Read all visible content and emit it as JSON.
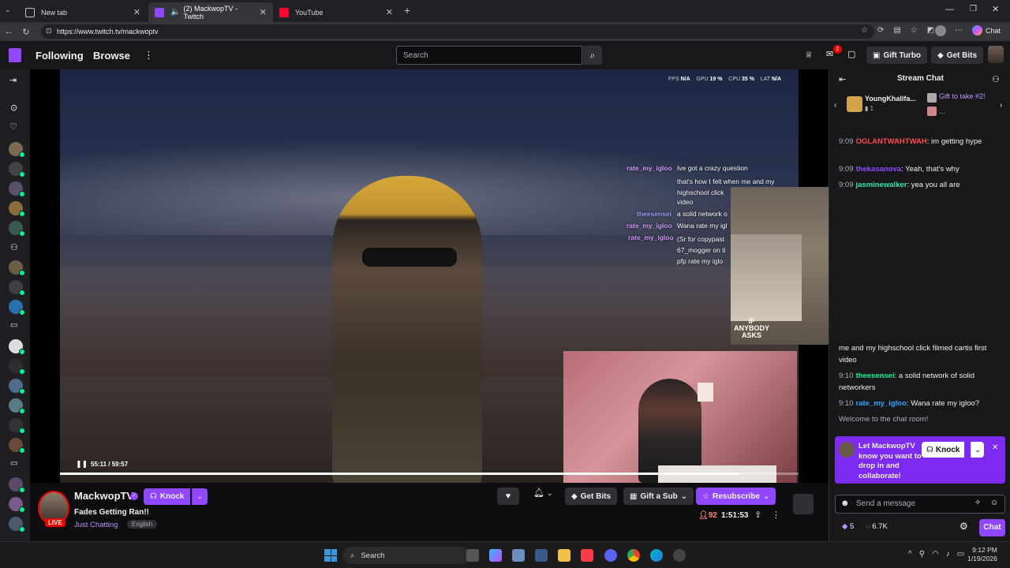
{
  "browser": {
    "tabs": [
      {
        "label": "New tab",
        "active": false
      },
      {
        "label": "(2) MackwopTV - Twitch",
        "active": true
      },
      {
        "label": "YouTube",
        "active": false
      }
    ],
    "url": "https://www.twitch.tv/mackwoptv",
    "copilot_label": "Chat"
  },
  "twitch_nav": {
    "following": "Following",
    "browse": "Browse",
    "search_placeholder": "Search",
    "gift_turbo": "Gift Turbo",
    "get_bits": "Get Bits",
    "notification_count": "2"
  },
  "stats": {
    "fps_label": "FPS",
    "fps_value": "N/A",
    "gpu_label": "GPU",
    "gpu_value": "19 %",
    "cpu_label": "CPU",
    "cpu_value": "35 %",
    "lat_label": "LAT",
    "lat_value": "N/A"
  },
  "video_overlay_chat": [
    {
      "name": "rate_my_igloo",
      "text": "Ive got a crazy question"
    },
    {
      "name": "",
      "text": "that's how I felt when me and my highschool click"
    },
    {
      "name": "",
      "text": "video"
    },
    {
      "name": "theesensei",
      "text": "a solid network o"
    },
    {
      "name": "rate_my_igloo",
      "text": "Wana rate my igl"
    },
    {
      "name": "rate_my_igloo",
      "text": "(Sr for copypast 67_mogger on ti pfp rate my iglo"
    }
  ],
  "overlay_brand": {
    "line1": "IF",
    "line2": "ANYBODY",
    "line3": "ASKS"
  },
  "player": {
    "time": "55:11 / 59:57",
    "progress": 0.92
  },
  "channel": {
    "name": "MackwopTV",
    "live_badge": "LIVE",
    "title": "Fades Getting Ran!!",
    "category": "Just Chatting",
    "language": "English",
    "knock": "Knock",
    "viewers": "92",
    "uptime": "1:51:53",
    "get_bits": "Get Bits",
    "gift_sub": "Gift a Sub",
    "resubscribe": "Resubscribe"
  },
  "chat": {
    "header": "Stream Chat",
    "gifter_name": "YoungKhalifa...",
    "gifter_count": "1",
    "gift_take": "Gift to take #2!",
    "gift_more": "...",
    "messages_top": [
      {
        "time": "9:09",
        "name": "OGLANTWAHTWAH",
        "text": "im getting hype",
        "color": "#ff4a4a"
      },
      {
        "time": "9:09",
        "name": "thekasanova",
        "text": "Yeah, that's why",
        "color": "#9147ff"
      },
      {
        "time": "9:09",
        "name": "jasminewalker",
        "text": "yea you all are",
        "color": "#2ee6a8"
      }
    ],
    "messages_bottom_cont": "me and my highschool click filmed cartis first video",
    "messages_bottom": [
      {
        "time": "9:10",
        "name": "theesensei",
        "text": "a solid network of solid networkers",
        "color": "#00f593"
      },
      {
        "time": "9:10",
        "name": "rate_my_igloo",
        "text": "Wana rate my igloo?",
        "color": "#2ea7ff"
      }
    ],
    "welcome": "Welcome to the chat room!",
    "promo_text": "Let MackwopTV know you want to drop in and collaborate!",
    "promo_knock": "Knock",
    "send_placeholder": "Send a message",
    "points": "5",
    "bits": "6.7K",
    "chat_button": "Chat"
  },
  "taskbar": {
    "search": "Search",
    "time": "9:12 PM",
    "date": "1/19/2026"
  },
  "colors": {
    "twitch_purple": "#9147ff",
    "live_red": "#eb0400",
    "online_green": "#00f593"
  }
}
